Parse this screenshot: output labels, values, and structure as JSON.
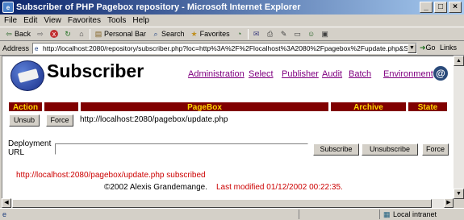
{
  "window": {
    "title": "Subscriber of PHP Pagebox repository - Microsoft Internet Explorer",
    "min": "_",
    "max": "□",
    "close": "×"
  },
  "menu": [
    "File",
    "Edit",
    "View",
    "Favorites",
    "Tools",
    "Help"
  ],
  "toolbar": {
    "back": "Back",
    "personal_bar": "Personal Bar",
    "search": "Search",
    "favorites": "Favorites"
  },
  "address": {
    "label": "Address",
    "url": "http://localhost:2080/repository/subscriber.php?loc=http%3A%2F%2Flocalhost%3A2080%2Fpagebox%2Fupdate.php&Subscribe=Subscri",
    "go": "Go",
    "links": "Links"
  },
  "page": {
    "title": "Subscriber",
    "nav": [
      "Administration",
      "Select",
      "Publisher",
      "Audit",
      "Batch",
      "Environment"
    ],
    "table_headers": [
      "Action",
      "",
      "PageBox",
      "Archive",
      "State"
    ],
    "row": {
      "unsub": "Unsub",
      "force": "Force",
      "pagebox": "http://localhost:2080/pagebox/update.php"
    },
    "deploy_label_1": "Deployment",
    "deploy_label_2": "URL",
    "deploy_value": "",
    "subscribe": "Subscribe",
    "unsubscribe": "Unsubscribe",
    "force": "Force",
    "message": "http://localhost:2080/pagebox/update.php subscribed",
    "copyright": "©2002 Alexis Grandemange.",
    "modified": "Last modified 01/12/2002 00:22:35."
  },
  "status": {
    "zone": "Local intranet"
  }
}
